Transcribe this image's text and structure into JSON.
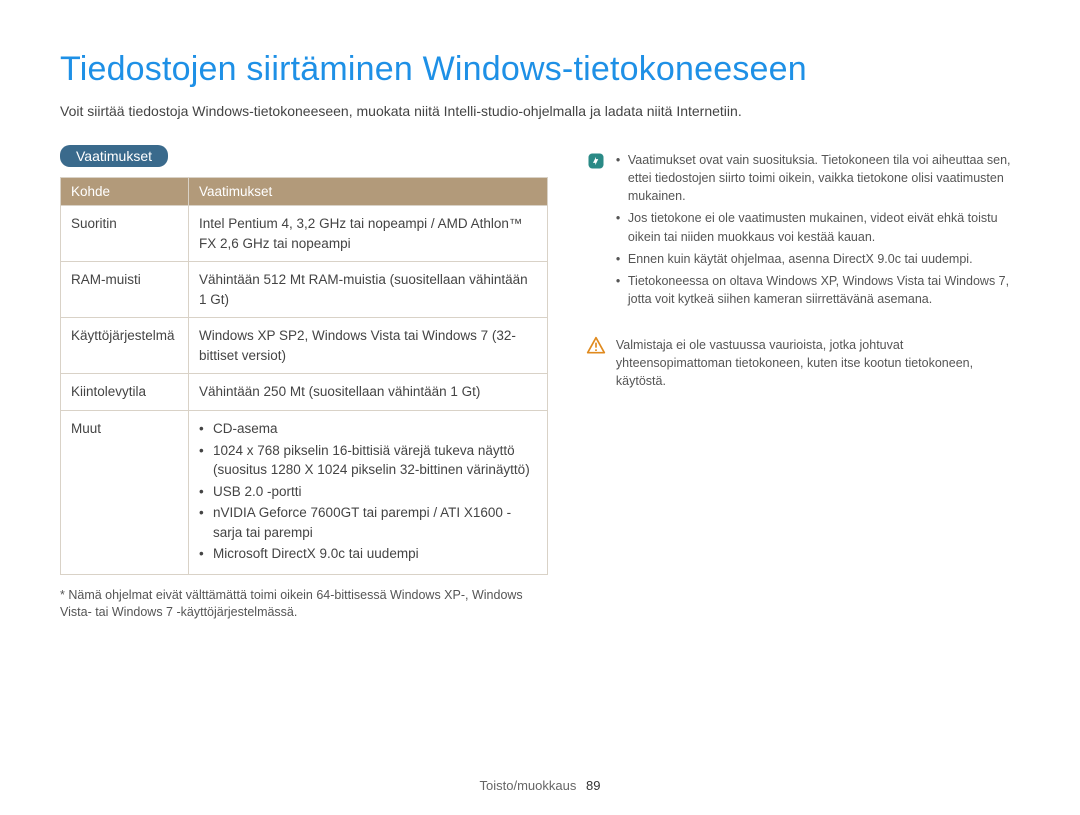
{
  "title": "Tiedostojen siirtäminen Windows-tietokoneeseen",
  "intro": "Voit siirtää tiedostoja Windows-tietokoneeseen, muokata niitä Intelli-studio-ohjelmalla ja ladata niitä Internetiin.",
  "section_label": "Vaatimukset",
  "table": {
    "headers": {
      "col1": "Kohde",
      "col2": "Vaatimukset"
    },
    "rows": {
      "cpu": {
        "label": "Suoritin",
        "value": "Intel Pentium 4, 3,2 GHz tai nopeampi / AMD Athlon™ FX 2,6 GHz tai nopeampi"
      },
      "ram": {
        "label": "RAM-muisti",
        "value": "Vähintään 512 Mt RAM-muistia (suositellaan vähintään 1 Gt)"
      },
      "os": {
        "label": "Käyttöjärjestelmä",
        "value": "Windows XP SP2, Windows Vista tai Windows 7 (32-bittiset versiot)"
      },
      "disk": {
        "label": "Kiintolevytila",
        "value": "Vähintään 250 Mt (suositellaan vähintään 1 Gt)"
      },
      "other": {
        "label": "Muut",
        "items": [
          "CD-asema",
          "1024 x 768 pikselin 16-bittisiä värejä tukeva näyttö (suositus 1280 X 1024 pikselin 32-bittinen värinäyttö)",
          "USB 2.0 -portti",
          "nVIDIA Geforce 7600GT tai parempi / ATI X1600 -sarja tai parempi",
          "Microsoft DirectX 9.0c tai uudempi"
        ]
      }
    }
  },
  "footnote": "* Nämä ohjelmat eivät välttämättä toimi oikein 64-bittisessä Windows XP-, Windows Vista- tai Windows 7 -käyttöjärjestelmässä.",
  "info_notes": [
    "Vaatimukset ovat vain suosituksia. Tietokoneen tila voi aiheuttaa sen, ettei tiedostojen siirto toimi oikein, vaikka tietokone olisi vaatimusten mukainen.",
    "Jos tietokone ei ole vaatimusten mukainen, videot eivät ehkä toistu oikein tai niiden muokkaus voi kestää kauan.",
    "Ennen kuin käytät ohjelmaa, asenna DirectX 9.0c tai uudempi.",
    "Tietokoneessa on oltava Windows XP, Windows Vista tai Windows 7, jotta voit kytkeä siihen kameran siirrettävänä asemana."
  ],
  "warning_note": "Valmistaja ei ole vastuussa vaurioista, jotka johtuvat yhteensopimattoman tietokoneen, kuten itse kootun tietokoneen, käytöstä.",
  "footer": {
    "section": "Toisto/muokkaus",
    "page": "89"
  }
}
